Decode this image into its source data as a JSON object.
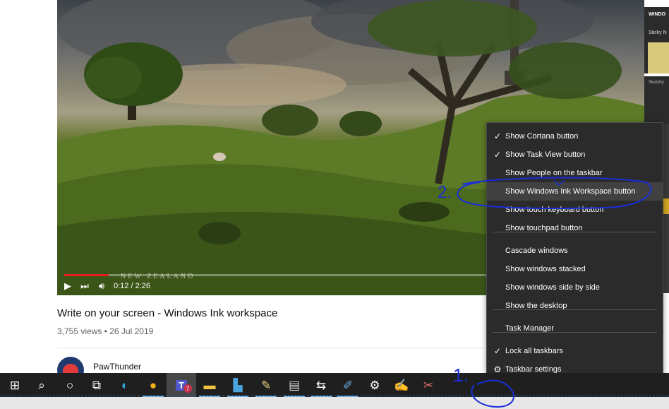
{
  "video": {
    "time": "0:12 / 2:26",
    "progress": 0.09,
    "watermark": "NEW ZEALAND"
  },
  "side_panel": {
    "title": "WINDO",
    "sticky": "Sticky N",
    "sketch": "Sketchp"
  },
  "page": {
    "video_title": "Write on your screen - Windows Ink workspace",
    "meta": "3,755 views • 26 Jul 2019",
    "channel": "PawThunder"
  },
  "context_menu": {
    "items": [
      {
        "label": "Show Cortana button",
        "checked": true
      },
      {
        "label": "Show Task View button",
        "checked": true
      },
      {
        "label": "Show People on the taskbar",
        "checked": false
      },
      {
        "label": "Show Windows Ink Workspace button",
        "checked": false,
        "highlighted": true
      },
      {
        "label": "Show touch keyboard button",
        "checked": false
      },
      {
        "label": "Show touchpad button",
        "checked": false
      },
      {
        "label": "Cascade windows",
        "checked": false
      },
      {
        "label": "Show windows stacked",
        "checked": false
      },
      {
        "label": "Show windows side by side",
        "checked": false
      },
      {
        "label": "Show the desktop",
        "checked": false
      },
      {
        "label": "Task Manager",
        "checked": false
      },
      {
        "label": "Lock all taskbars",
        "checked": true
      },
      {
        "label": "Taskbar settings",
        "checked": false,
        "icon": "gear-icon"
      }
    ]
  },
  "annotations": {
    "step1": "1.",
    "step2": "2."
  },
  "taskbar": {
    "icons": [
      "windows-start-icon",
      "search-icon",
      "cortana-icon",
      "task-view-icon",
      "edge-icon",
      "chrome-icon",
      "teams-icon",
      "file-explorer-icon",
      "network-drive-icon",
      "notes-icon",
      "notepad-icon",
      "teamviewer-icon",
      "pen-app-icon",
      "settings-gear-icon",
      "paint-icon",
      "snipping-icon"
    ],
    "teams_badge": "7"
  }
}
